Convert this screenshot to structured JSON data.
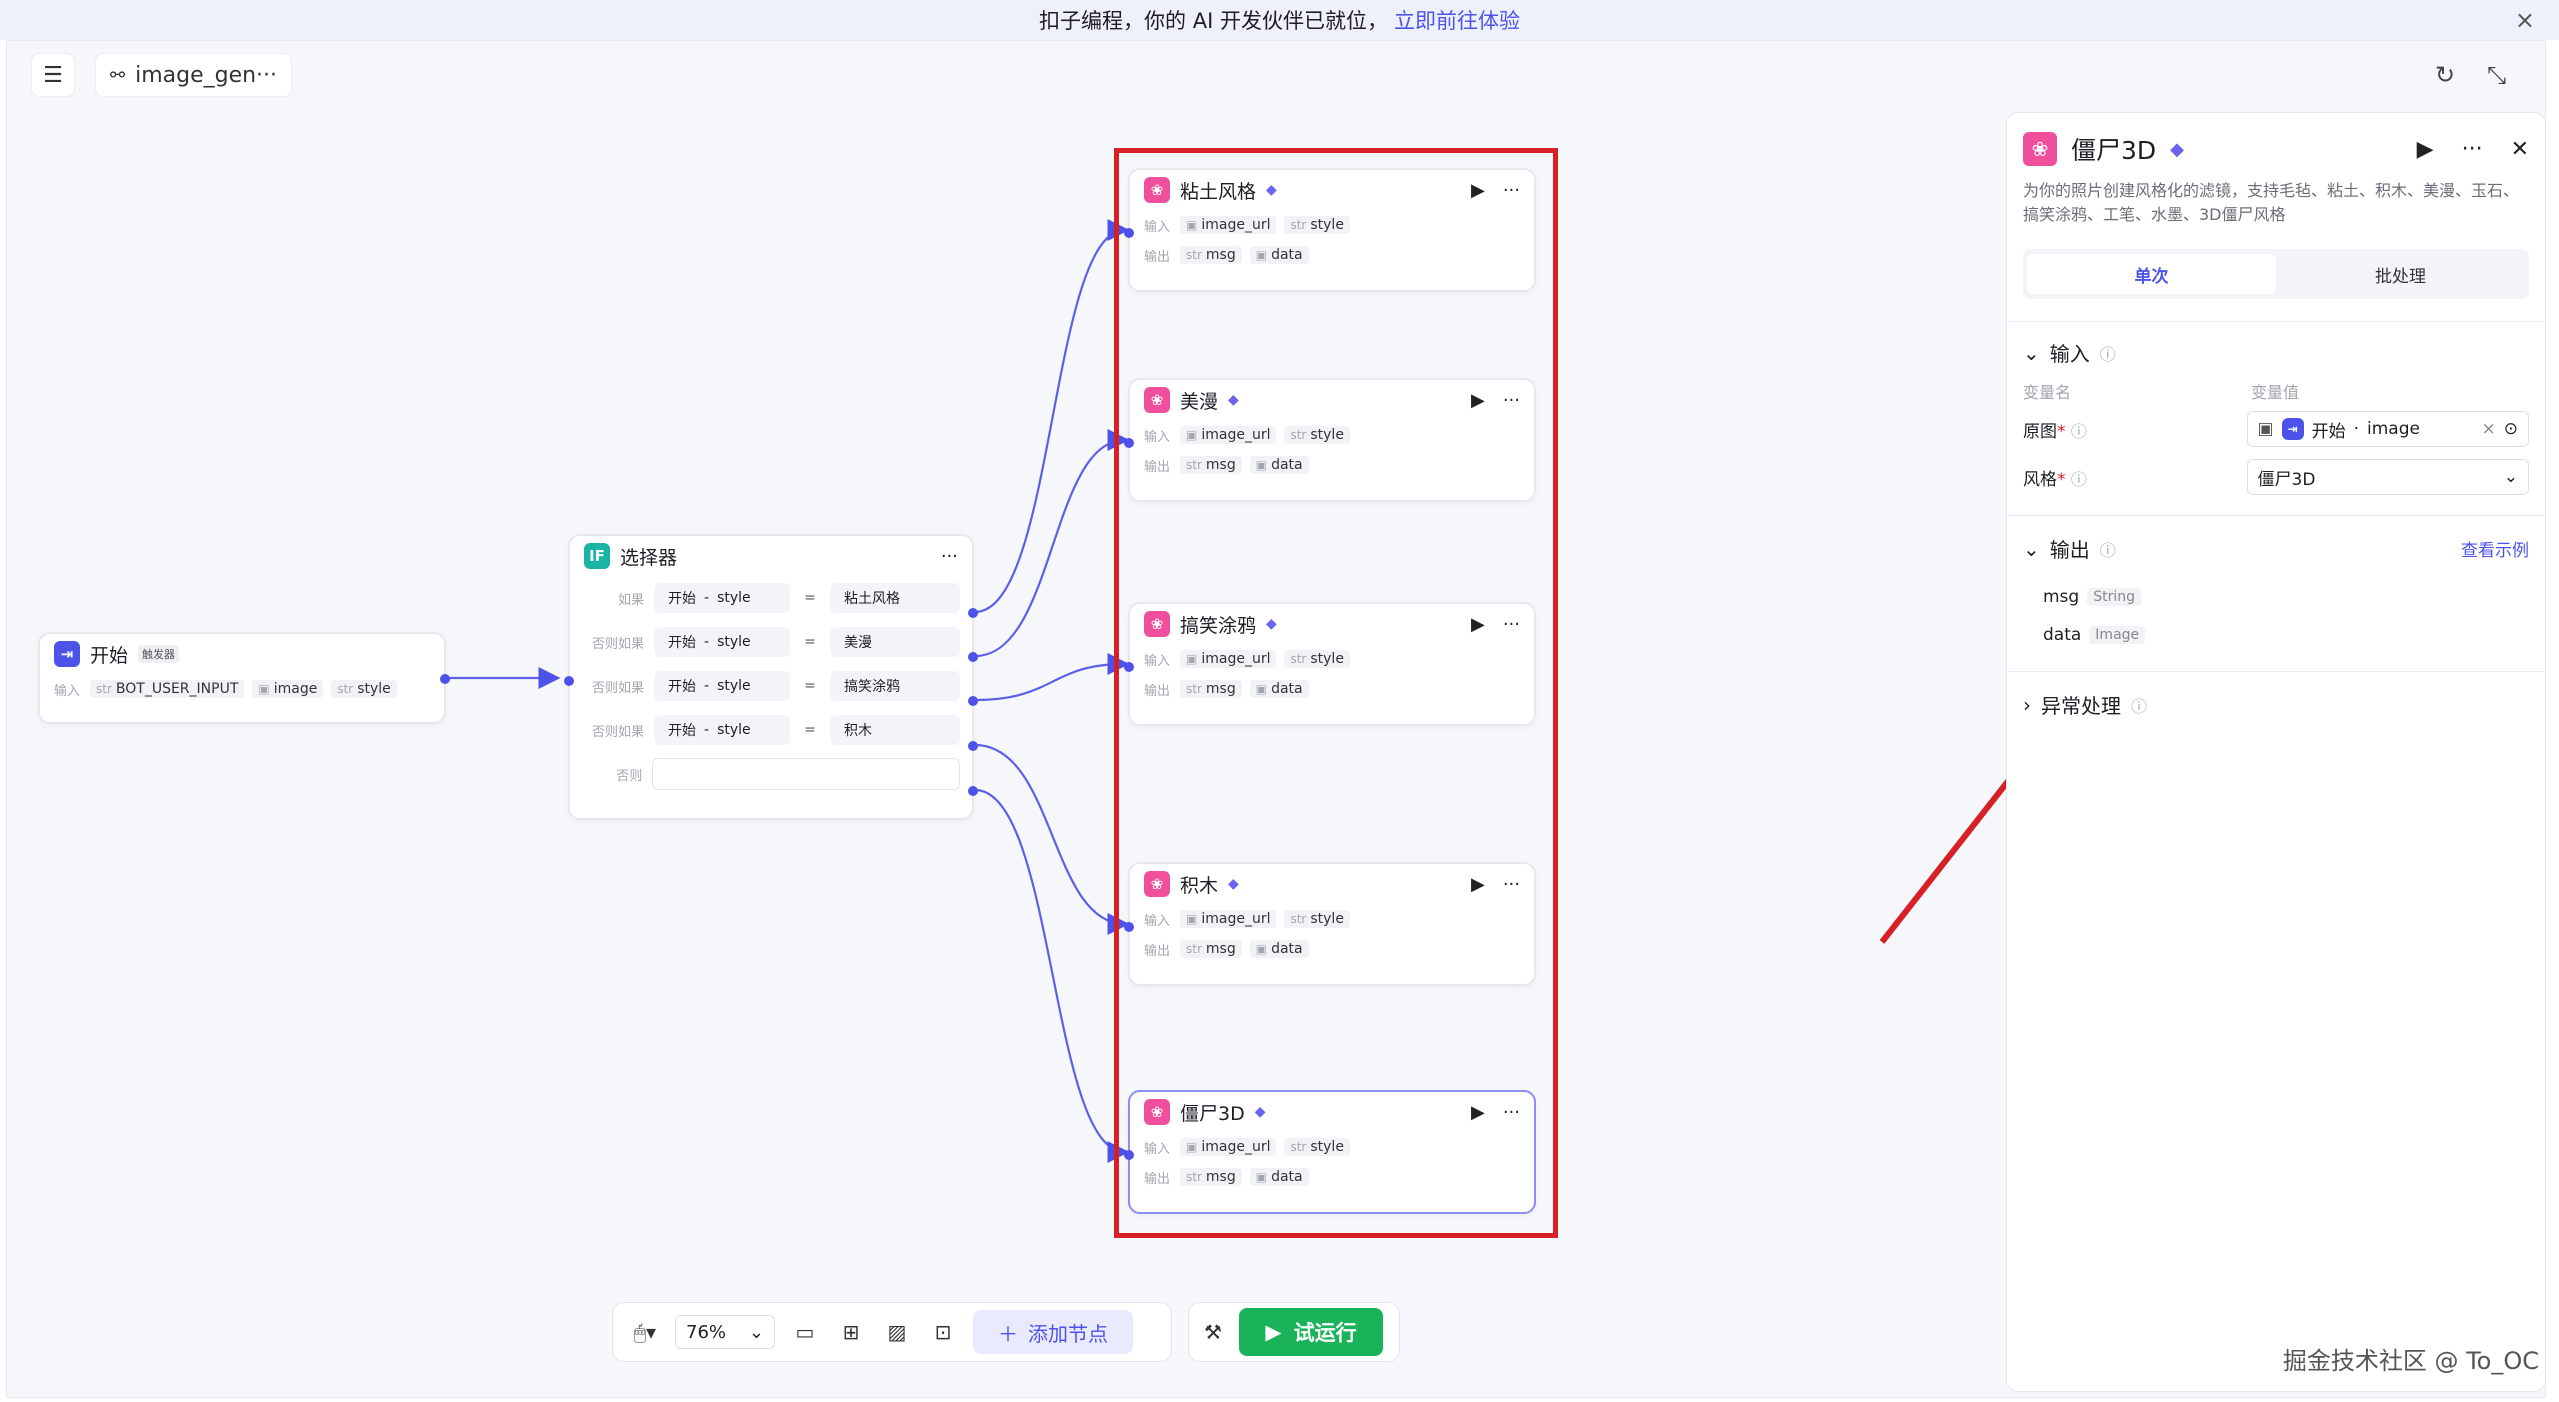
{
  "banner": {
    "text": "扣子编程，你的 AI 开发伙伴已就位，",
    "link": "立即前往体验"
  },
  "header": {
    "flow_name": "image_gen···"
  },
  "start_node": {
    "title": "开始",
    "trigger": "触发器",
    "input_label": "输入",
    "params": [
      {
        "type": "str",
        "name": "BOT_USER_INPUT"
      },
      {
        "type": "img",
        "name": "image"
      },
      {
        "type": "str",
        "name": "style"
      }
    ]
  },
  "selector_node": {
    "title": "选择器",
    "icon_text": "IF",
    "rows": [
      {
        "label": "如果",
        "left_node": "开始",
        "left_var": "style",
        "op": "=",
        "value": "粘土风格"
      },
      {
        "label": "否则如果",
        "left_node": "开始",
        "left_var": "style",
        "op": "=",
        "value": "美漫"
      },
      {
        "label": "否则如果",
        "left_node": "开始",
        "left_var": "style",
        "op": "=",
        "value": "搞笑涂鸦"
      },
      {
        "label": "否则如果",
        "left_node": "开始",
        "left_var": "style",
        "op": "=",
        "value": "积木"
      }
    ],
    "else_label": "否则"
  },
  "plugin_nodes": [
    {
      "title": "粘土风格"
    },
    {
      "title": "美漫"
    },
    {
      "title": "搞笑涂鸦"
    },
    {
      "title": "积木"
    },
    {
      "title": "僵尸3D"
    }
  ],
  "node_io": {
    "input_label": "输入",
    "output_label": "输出",
    "inputs": [
      {
        "type": "img",
        "name": "image_url"
      },
      {
        "type": "str",
        "name": "style"
      }
    ],
    "outputs": [
      {
        "type": "str",
        "name": "msg"
      },
      {
        "type": "img",
        "name": "data"
      }
    ]
  },
  "toolbar": {
    "zoom": "76%",
    "add_node": "添加节点",
    "run": "试运行"
  },
  "panel": {
    "title": "僵尸3D",
    "description": "为你的照片创建风格化的滤镜，支持毛毡、粘土、积木、美漫、玉石、搞笑涂鸦、工笔、水墨、3D僵尸风格",
    "tabs": [
      "单次",
      "批处理"
    ],
    "input_section": "输入",
    "col_name": "变量名",
    "col_value": "变量值",
    "fields": [
      {
        "label": "原图",
        "ref_node": "开始",
        "ref_var": "image"
      },
      {
        "label": "风格",
        "value": "僵尸3D"
      }
    ],
    "output_section": "输出",
    "view_example": "查看示例",
    "outputs": [
      {
        "name": "msg",
        "type": "String"
      },
      {
        "name": "data",
        "type": "Image"
      }
    ],
    "exception_section": "异常处理"
  },
  "watermark": "掘金技术社区 @ To_OC",
  "colors": {
    "accent": "#4d53e8",
    "run_green": "#1bb35a",
    "highlight_red": "#d71f26",
    "plugin_pink": "#f04f9b"
  }
}
